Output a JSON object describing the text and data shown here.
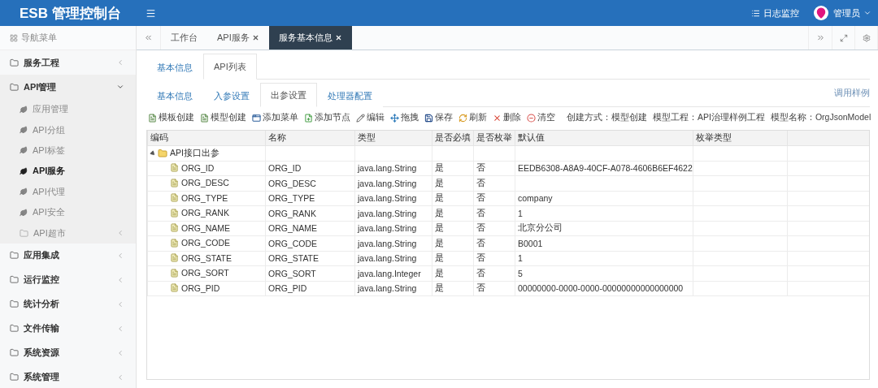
{
  "header": {
    "title": "ESB 管理控制台",
    "links": [
      {
        "label": "日志监控"
      }
    ],
    "user": "管理员"
  },
  "sidebar": {
    "title": "导航菜单",
    "items": [
      {
        "label": "服务工程",
        "expanded": false,
        "selected": false
      },
      {
        "label": "API管理",
        "expanded": true,
        "selected": false,
        "children": [
          {
            "label": "应用管理",
            "kind": "leaf",
            "selected": false
          },
          {
            "label": "API分组",
            "kind": "leaf",
            "selected": false
          },
          {
            "label": "API标签",
            "kind": "leaf",
            "selected": false
          },
          {
            "label": "API服务",
            "kind": "leaf",
            "selected": true
          },
          {
            "label": "API代理",
            "kind": "leaf",
            "selected": false
          },
          {
            "label": "API安全",
            "kind": "leaf",
            "selected": false
          },
          {
            "label": "API超市",
            "kind": "folder",
            "selected": false
          }
        ]
      },
      {
        "label": "应用集成",
        "expanded": false,
        "selected": false
      },
      {
        "label": "运行监控",
        "expanded": false,
        "selected": false
      },
      {
        "label": "统计分析",
        "expanded": false,
        "selected": false
      },
      {
        "label": "文件传输",
        "expanded": false,
        "selected": false
      },
      {
        "label": "系统资源",
        "expanded": false,
        "selected": false
      },
      {
        "label": "系统管理",
        "expanded": false,
        "selected": false
      }
    ]
  },
  "page_tabs": [
    {
      "label": "工作台",
      "closable": false,
      "selected": false
    },
    {
      "label": "API服务",
      "closable": true,
      "selected": false
    },
    {
      "label": "服务基本信息",
      "closable": true,
      "selected": true
    }
  ],
  "content_tabs": [
    {
      "label": "基本信息",
      "selected": false
    },
    {
      "label": "API列表",
      "selected": true
    }
  ],
  "sub_tabs": [
    {
      "label": "基本信息",
      "selected": false
    },
    {
      "label": "入参设置",
      "selected": false
    },
    {
      "label": "出参设置",
      "selected": true
    },
    {
      "label": "处理器配置",
      "selected": false
    }
  ],
  "sample_link": "调用样例",
  "toolbar": [
    {
      "label": "模板创建",
      "kind": "template"
    },
    {
      "label": "模型创建",
      "kind": "template"
    },
    {
      "label": "添加菜单",
      "kind": "window"
    },
    {
      "label": "添加节点",
      "kind": "file"
    },
    {
      "label": "编辑",
      "kind": "edit"
    },
    {
      "label": "拖拽",
      "kind": "move"
    },
    {
      "label": "保存",
      "kind": "save"
    },
    {
      "label": "刷新",
      "kind": "refresh"
    },
    {
      "label": "删除",
      "kind": "delete"
    },
    {
      "label": "清空",
      "kind": "clear"
    }
  ],
  "model_info": [
    "创建方式：模型创建",
    "模型工程：API治理样例工程",
    "模型名称：OrgJsonModel"
  ],
  "table": {
    "columns": [
      "编码",
      "名称",
      "类型",
      "是否必填",
      "是否枚举",
      "默认值",
      "枚举类型"
    ],
    "rows": [
      {
        "code": "API接口出参",
        "expanded": true,
        "children": [
          {
            "code": "ORG_ID",
            "name": "ORG_ID",
            "type": "java.lang.String",
            "required": "是",
            "enum": "否",
            "default": "EEDB6308-A8A9-40CF-A078-4606B6EF4622"
          },
          {
            "code": "ORG_DESC",
            "name": "ORG_DESC",
            "type": "java.lang.String",
            "required": "是",
            "enum": "否"
          },
          {
            "code": "ORG_TYPE",
            "name": "ORG_TYPE",
            "type": "java.lang.String",
            "required": "是",
            "enum": "否",
            "default": "company"
          },
          {
            "code": "ORG_RANK",
            "name": "ORG_RANK",
            "type": "java.lang.String",
            "required": "是",
            "enum": "否",
            "default": "1"
          },
          {
            "code": "ORG_NAME",
            "name": "ORG_NAME",
            "type": "java.lang.String",
            "required": "是",
            "enum": "否",
            "default": "北京分公司"
          },
          {
            "code": "ORG_CODE",
            "name": "ORG_CODE",
            "type": "java.lang.String",
            "required": "是",
            "enum": "否",
            "default": "B0001"
          },
          {
            "code": "ORG_STATE",
            "name": "ORG_STATE",
            "type": "java.lang.String",
            "required": "是",
            "enum": "否",
            "default": "1"
          },
          {
            "code": "ORG_SORT",
            "name": "ORG_SORT",
            "type": "java.lang.Integer",
            "required": "是",
            "enum": "否",
            "default": "5"
          },
          {
            "code": "ORG_PID",
            "name": "ORG_PID",
            "type": "java.lang.String",
            "required": "是",
            "enum": "否",
            "default": "00000000-0000-0000-00000000000000000"
          }
        ]
      }
    ]
  }
}
